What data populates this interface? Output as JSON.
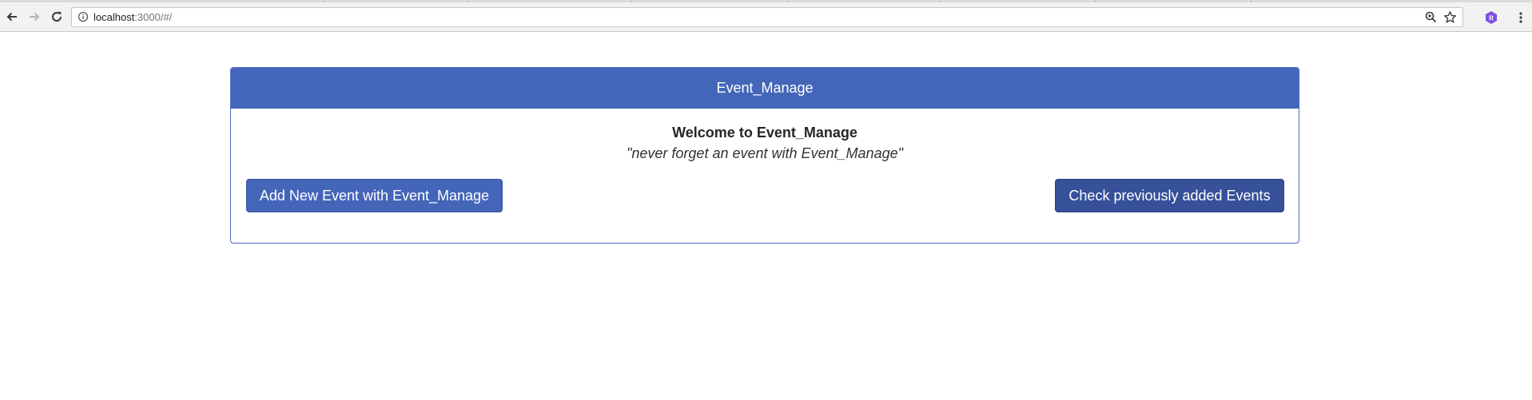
{
  "browser": {
    "url_host": "localhost",
    "url_rest": ":3000/#/",
    "extension_badge": "R"
  },
  "card": {
    "header_title": "Event_Manage",
    "welcome_heading": "Welcome to Event_Manage",
    "tagline": "\"never forget an event with Event_Manage\"",
    "add_button_label": "Add New Event with Event_Manage",
    "check_button_label": "Check previously added Events"
  },
  "colors": {
    "primary": "#4466b9",
    "primary_dark": "#36509a"
  }
}
